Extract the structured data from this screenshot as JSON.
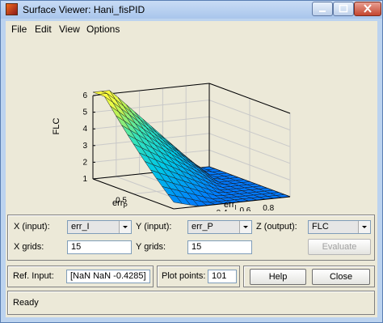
{
  "window": {
    "title": "Surface Viewer: Hani_fisPID"
  },
  "menu": [
    "File",
    "Edit",
    "View",
    "Options"
  ],
  "plot": {
    "zlabel": "FLC",
    "xlabel": "err",
    "xlabel_sub": "P",
    "ylabel": "err",
    "ylabel_sub": "I",
    "z_ticks": [
      "6",
      "5",
      "4",
      "3",
      "2",
      "1"
    ],
    "p_ticks": [
      "0.5",
      "0"
    ],
    "i_ticks": [
      "0",
      "0.2",
      "0.4",
      "0.6",
      "0.8"
    ]
  },
  "controls": {
    "x_input_label": "X (input):",
    "x_input_value": "err_I",
    "y_input_label": "Y (input):",
    "y_input_value": "err_P",
    "z_output_label": "Z (output):",
    "z_output_value": "FLC",
    "x_grids_label": "X grids:",
    "x_grids_value": "15",
    "y_grids_label": "Y grids:",
    "y_grids_value": "15",
    "evaluate_label": "Evaluate",
    "ref_input_label": "Ref. Input:",
    "ref_input_value": "[NaN NaN -0.4285]",
    "plot_points_label": "Plot points:",
    "plot_points_value": "101",
    "help_label": "Help",
    "close_label": "Close"
  },
  "status": {
    "text": "Ready"
  },
  "colors": {
    "surface_low": "#00a0ff",
    "surface_mid": "#20d8d0",
    "surface_high": "#ffff40",
    "evaluate_disabled_text": "#a0a0a0"
  }
}
